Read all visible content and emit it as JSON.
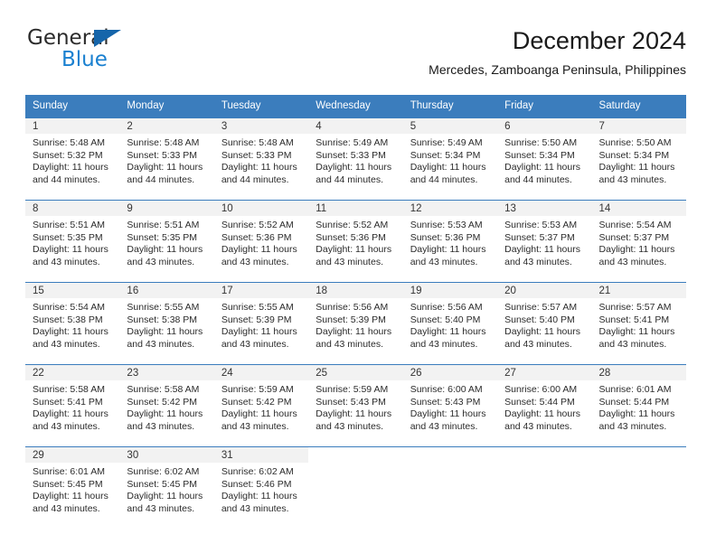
{
  "brand": {
    "name_top": "General",
    "name_bottom": "Blue",
    "triangle_color": "#1565aa",
    "blue_color": "#1a80d0"
  },
  "header": {
    "title": "December 2024",
    "subtitle": "Mercedes, Zamboanga Peninsula, Philippines"
  },
  "theme": {
    "header_blue": "#3b7dbd",
    "daynum_bg": "#f2f2f2",
    "text": "#2b2b2b"
  },
  "weekdays": [
    "Sunday",
    "Monday",
    "Tuesday",
    "Wednesday",
    "Thursday",
    "Friday",
    "Saturday"
  ],
  "weeks": [
    [
      {
        "day": "1",
        "sunrise": "Sunrise: 5:48 AM",
        "sunset": "Sunset: 5:32 PM",
        "daylight1": "Daylight: 11 hours",
        "daylight2": "and 44 minutes."
      },
      {
        "day": "2",
        "sunrise": "Sunrise: 5:48 AM",
        "sunset": "Sunset: 5:33 PM",
        "daylight1": "Daylight: 11 hours",
        "daylight2": "and 44 minutes."
      },
      {
        "day": "3",
        "sunrise": "Sunrise: 5:48 AM",
        "sunset": "Sunset: 5:33 PM",
        "daylight1": "Daylight: 11 hours",
        "daylight2": "and 44 minutes."
      },
      {
        "day": "4",
        "sunrise": "Sunrise: 5:49 AM",
        "sunset": "Sunset: 5:33 PM",
        "daylight1": "Daylight: 11 hours",
        "daylight2": "and 44 minutes."
      },
      {
        "day": "5",
        "sunrise": "Sunrise: 5:49 AM",
        "sunset": "Sunset: 5:34 PM",
        "daylight1": "Daylight: 11 hours",
        "daylight2": "and 44 minutes."
      },
      {
        "day": "6",
        "sunrise": "Sunrise: 5:50 AM",
        "sunset": "Sunset: 5:34 PM",
        "daylight1": "Daylight: 11 hours",
        "daylight2": "and 44 minutes."
      },
      {
        "day": "7",
        "sunrise": "Sunrise: 5:50 AM",
        "sunset": "Sunset: 5:34 PM",
        "daylight1": "Daylight: 11 hours",
        "daylight2": "and 43 minutes."
      }
    ],
    [
      {
        "day": "8",
        "sunrise": "Sunrise: 5:51 AM",
        "sunset": "Sunset: 5:35 PM",
        "daylight1": "Daylight: 11 hours",
        "daylight2": "and 43 minutes."
      },
      {
        "day": "9",
        "sunrise": "Sunrise: 5:51 AM",
        "sunset": "Sunset: 5:35 PM",
        "daylight1": "Daylight: 11 hours",
        "daylight2": "and 43 minutes."
      },
      {
        "day": "10",
        "sunrise": "Sunrise: 5:52 AM",
        "sunset": "Sunset: 5:36 PM",
        "daylight1": "Daylight: 11 hours",
        "daylight2": "and 43 minutes."
      },
      {
        "day": "11",
        "sunrise": "Sunrise: 5:52 AM",
        "sunset": "Sunset: 5:36 PM",
        "daylight1": "Daylight: 11 hours",
        "daylight2": "and 43 minutes."
      },
      {
        "day": "12",
        "sunrise": "Sunrise: 5:53 AM",
        "sunset": "Sunset: 5:36 PM",
        "daylight1": "Daylight: 11 hours",
        "daylight2": "and 43 minutes."
      },
      {
        "day": "13",
        "sunrise": "Sunrise: 5:53 AM",
        "sunset": "Sunset: 5:37 PM",
        "daylight1": "Daylight: 11 hours",
        "daylight2": "and 43 minutes."
      },
      {
        "day": "14",
        "sunrise": "Sunrise: 5:54 AM",
        "sunset": "Sunset: 5:37 PM",
        "daylight1": "Daylight: 11 hours",
        "daylight2": "and 43 minutes."
      }
    ],
    [
      {
        "day": "15",
        "sunrise": "Sunrise: 5:54 AM",
        "sunset": "Sunset: 5:38 PM",
        "daylight1": "Daylight: 11 hours",
        "daylight2": "and 43 minutes."
      },
      {
        "day": "16",
        "sunrise": "Sunrise: 5:55 AM",
        "sunset": "Sunset: 5:38 PM",
        "daylight1": "Daylight: 11 hours",
        "daylight2": "and 43 minutes."
      },
      {
        "day": "17",
        "sunrise": "Sunrise: 5:55 AM",
        "sunset": "Sunset: 5:39 PM",
        "daylight1": "Daylight: 11 hours",
        "daylight2": "and 43 minutes."
      },
      {
        "day": "18",
        "sunrise": "Sunrise: 5:56 AM",
        "sunset": "Sunset: 5:39 PM",
        "daylight1": "Daylight: 11 hours",
        "daylight2": "and 43 minutes."
      },
      {
        "day": "19",
        "sunrise": "Sunrise: 5:56 AM",
        "sunset": "Sunset: 5:40 PM",
        "daylight1": "Daylight: 11 hours",
        "daylight2": "and 43 minutes."
      },
      {
        "day": "20",
        "sunrise": "Sunrise: 5:57 AM",
        "sunset": "Sunset: 5:40 PM",
        "daylight1": "Daylight: 11 hours",
        "daylight2": "and 43 minutes."
      },
      {
        "day": "21",
        "sunrise": "Sunrise: 5:57 AM",
        "sunset": "Sunset: 5:41 PM",
        "daylight1": "Daylight: 11 hours",
        "daylight2": "and 43 minutes."
      }
    ],
    [
      {
        "day": "22",
        "sunrise": "Sunrise: 5:58 AM",
        "sunset": "Sunset: 5:41 PM",
        "daylight1": "Daylight: 11 hours",
        "daylight2": "and 43 minutes."
      },
      {
        "day": "23",
        "sunrise": "Sunrise: 5:58 AM",
        "sunset": "Sunset: 5:42 PM",
        "daylight1": "Daylight: 11 hours",
        "daylight2": "and 43 minutes."
      },
      {
        "day": "24",
        "sunrise": "Sunrise: 5:59 AM",
        "sunset": "Sunset: 5:42 PM",
        "daylight1": "Daylight: 11 hours",
        "daylight2": "and 43 minutes."
      },
      {
        "day": "25",
        "sunrise": "Sunrise: 5:59 AM",
        "sunset": "Sunset: 5:43 PM",
        "daylight1": "Daylight: 11 hours",
        "daylight2": "and 43 minutes."
      },
      {
        "day": "26",
        "sunrise": "Sunrise: 6:00 AM",
        "sunset": "Sunset: 5:43 PM",
        "daylight1": "Daylight: 11 hours",
        "daylight2": "and 43 minutes."
      },
      {
        "day": "27",
        "sunrise": "Sunrise: 6:00 AM",
        "sunset": "Sunset: 5:44 PM",
        "daylight1": "Daylight: 11 hours",
        "daylight2": "and 43 minutes."
      },
      {
        "day": "28",
        "sunrise": "Sunrise: 6:01 AM",
        "sunset": "Sunset: 5:44 PM",
        "daylight1": "Daylight: 11 hours",
        "daylight2": "and 43 minutes."
      }
    ],
    [
      {
        "day": "29",
        "sunrise": "Sunrise: 6:01 AM",
        "sunset": "Sunset: 5:45 PM",
        "daylight1": "Daylight: 11 hours",
        "daylight2": "and 43 minutes."
      },
      {
        "day": "30",
        "sunrise": "Sunrise: 6:02 AM",
        "sunset": "Sunset: 5:45 PM",
        "daylight1": "Daylight: 11 hours",
        "daylight2": "and 43 minutes."
      },
      {
        "day": "31",
        "sunrise": "Sunrise: 6:02 AM",
        "sunset": "Sunset: 5:46 PM",
        "daylight1": "Daylight: 11 hours",
        "daylight2": "and 43 minutes."
      },
      {
        "day": "",
        "sunrise": "",
        "sunset": "",
        "daylight1": "",
        "daylight2": ""
      },
      {
        "day": "",
        "sunrise": "",
        "sunset": "",
        "daylight1": "",
        "daylight2": ""
      },
      {
        "day": "",
        "sunrise": "",
        "sunset": "",
        "daylight1": "",
        "daylight2": ""
      },
      {
        "day": "",
        "sunrise": "",
        "sunset": "",
        "daylight1": "",
        "daylight2": ""
      }
    ]
  ]
}
